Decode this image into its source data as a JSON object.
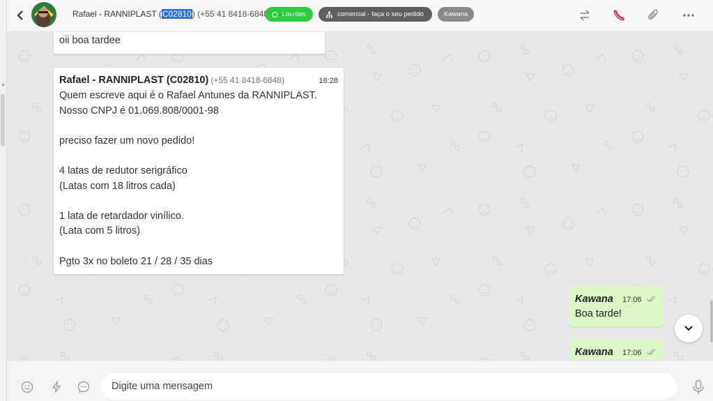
{
  "header": {
    "contact_name": "Rafael - RANNIPLAST (",
    "contact_code": "C02810",
    "contact_phone": ") (+55 41 8418-6848)",
    "tags": [
      {
        "label": "Lourdes",
        "color": "#2ecc40",
        "icon": "whatsapp-icon"
      },
      {
        "label": "comercial - faça o seu pedido",
        "color": "#5f5f5f",
        "icon": "sitemap-icon"
      },
      {
        "label": "Kawana",
        "color": "#8a8a8a"
      }
    ],
    "actions": [
      "transfer-icon",
      "end-call-icon",
      "attachment-icon",
      "more-icon"
    ]
  },
  "messages": {
    "prev_text": "oii boa tardee",
    "main": {
      "sender": "Rafael - RANNIPLAST (C02810)",
      "phone": "(+55 41 8418-6848)",
      "time": "16:28",
      "lines": [
        "Quem escreve aqui é o Rafael Antunes da RANNIPLAST.",
        "Nosso CNPJ é 01.069.808/0001-98",
        "",
        "preciso fazer um novo pedido!",
        "",
        "4 latas de redutor serigráfico",
        "(Latas com 18 litros cada)",
        "",
        "1 lata de retardador vinílico.",
        "(Lata com 5 litros)",
        "",
        "Pgto 3x no boleto 21 / 28 / 35 dias"
      ]
    },
    "out1": {
      "name": "Kawana",
      "time": "17:06",
      "text": "Boa tarde!"
    },
    "out2": {
      "name": "Kawana",
      "time": "17:06"
    }
  },
  "composer": {
    "placeholder": "Digite uma mensagem",
    "icons": [
      "emoji-icon",
      "lightning-icon",
      "quick-reply-icon",
      "microphone-icon"
    ]
  },
  "colors": {
    "outgoing_bubble": "#dcf8c6",
    "selection": "#2d6fd6",
    "chat_bg": "#e9e9e9"
  }
}
